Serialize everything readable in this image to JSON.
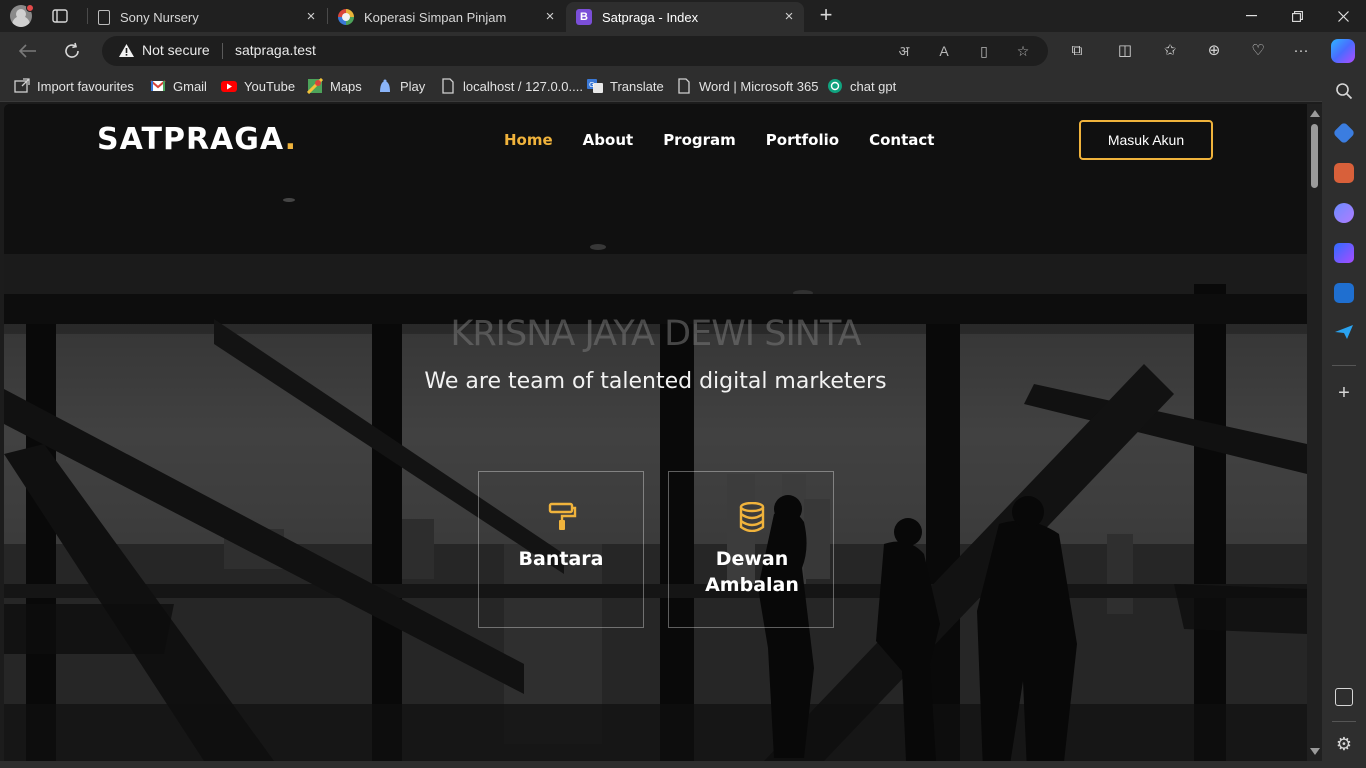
{
  "browser": {
    "tabs": [
      {
        "title": "Sony Nursery",
        "icon": "page-icon"
      },
      {
        "title": "Koperasi Simpan Pinjam",
        "icon": "koperasi-favicon"
      },
      {
        "title": "Satpraga - Index",
        "icon": "bootstrap-favicon",
        "active": true
      }
    ],
    "address": {
      "security_label": "Not secure",
      "url": "satpraga.test"
    },
    "bookmarks": [
      {
        "label": "Import favourites",
        "icon": "import-icon"
      },
      {
        "label": "Gmail",
        "icon": "gmail-icon"
      },
      {
        "label": "YouTube",
        "icon": "youtube-icon"
      },
      {
        "label": "Maps",
        "icon": "maps-icon"
      },
      {
        "label": "Play",
        "icon": "play-icon"
      },
      {
        "label": "localhost / 127.0.0....",
        "icon": "page-icon"
      },
      {
        "label": "Translate",
        "icon": "translate-icon"
      },
      {
        "label": "Word | Microsoft 365",
        "icon": "page-icon"
      },
      {
        "label": "chat gpt",
        "icon": "chatgpt-icon"
      }
    ],
    "colors": {
      "chrome": "#2e2e2e",
      "tabstrip": "#202020",
      "accent": "#f0b33c"
    }
  },
  "site": {
    "logo": {
      "text": "SATPRAGA",
      "dot": "."
    },
    "nav": [
      {
        "label": "Home",
        "active": true
      },
      {
        "label": "About"
      },
      {
        "label": "Program"
      },
      {
        "label": "Portfolio"
      },
      {
        "label": "Contact"
      }
    ],
    "login_label": "Masuk Akun",
    "hero": {
      "title": "KRISNA JAYA DEWI SINTA",
      "subtitle": "We are team of talented digital marketers"
    },
    "cards": [
      {
        "title": "Bantara",
        "icon": "paint-roller-icon"
      },
      {
        "title": "Dewan Ambalan",
        "icon": "database-icon"
      }
    ]
  }
}
